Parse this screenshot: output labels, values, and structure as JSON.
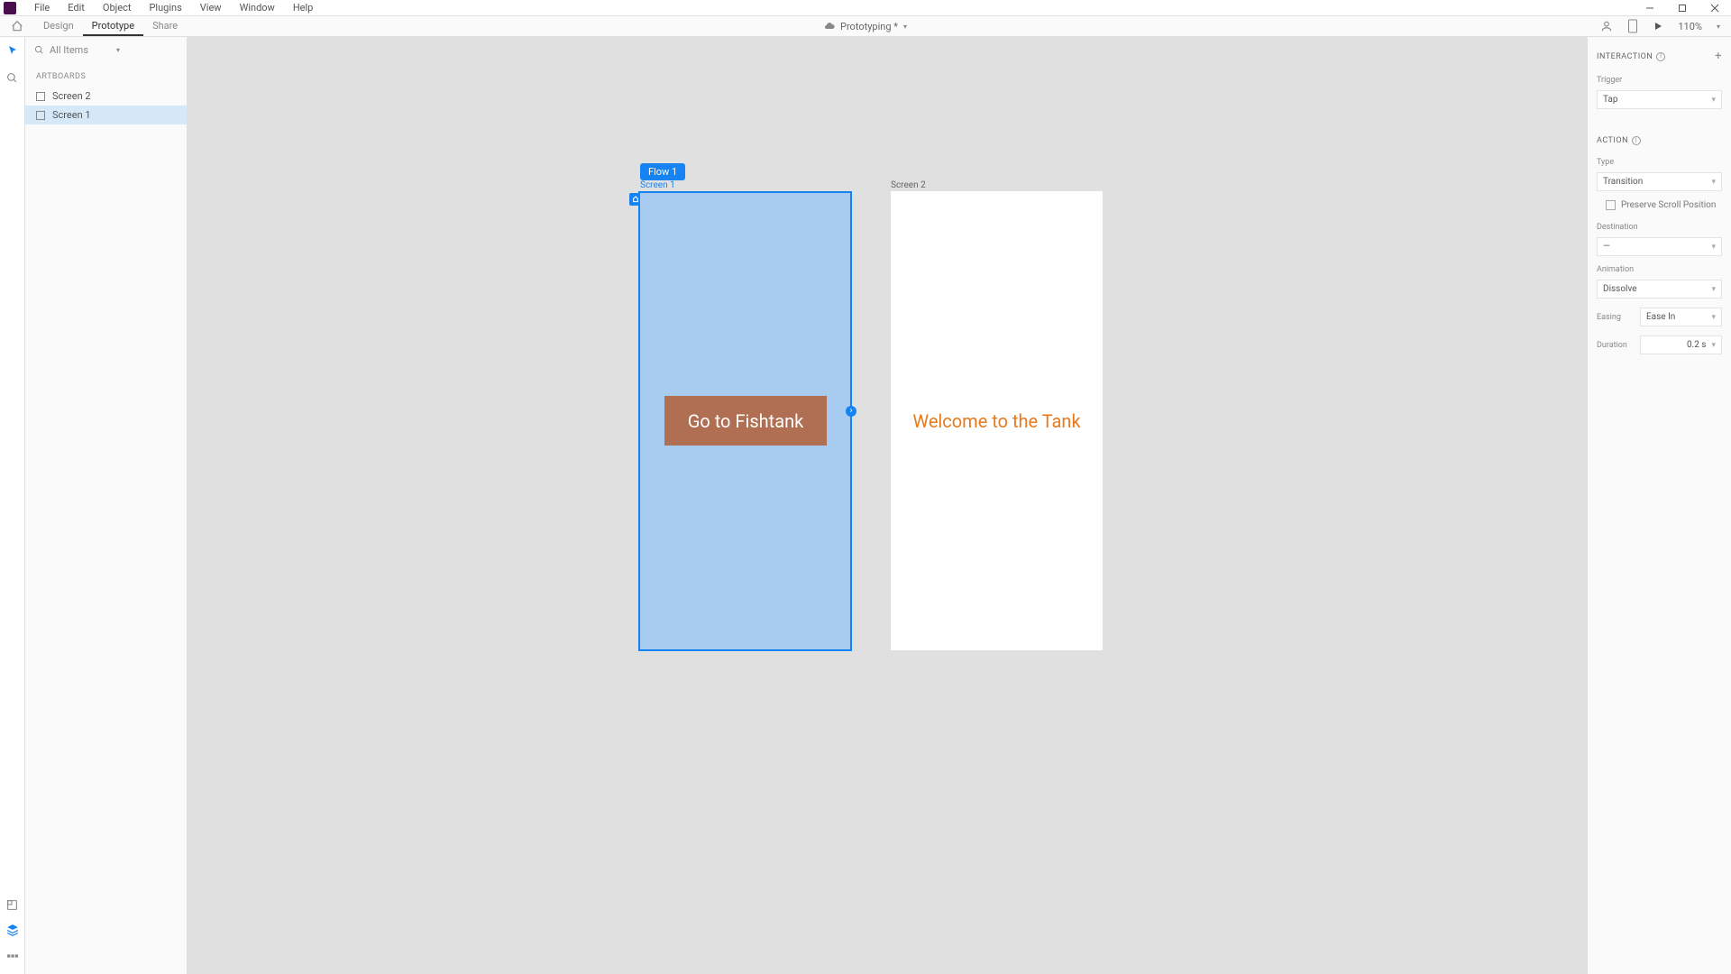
{
  "menu": {
    "file": "File",
    "edit": "Edit",
    "object": "Object",
    "plugins": "Plugins",
    "view": "View",
    "window": "Window",
    "help": "Help"
  },
  "tabs": {
    "design": "Design",
    "prototype": "Prototype",
    "share": "Share"
  },
  "doc": {
    "name": "Prototyping *"
  },
  "zoom": "110%",
  "left": {
    "search_placeholder": "All Items",
    "section": "ARTBOARDS",
    "items": [
      {
        "label": "Screen 2",
        "selected": false
      },
      {
        "label": "Screen 1",
        "selected": true
      }
    ]
  },
  "canvas": {
    "flow_badge": "Flow 1",
    "artboard1_label": "Screen 1",
    "artboard2_label": "Screen 2",
    "button_text": "Go to Fishtank",
    "welcome_text": "Welcome to the Tank"
  },
  "right": {
    "interaction": "INTERACTION",
    "trigger_label": "Trigger",
    "trigger_value": "Tap",
    "action": "ACTION",
    "type_label": "Type",
    "type_value": "Transition",
    "preserve_scroll": "Preserve Scroll Position",
    "destination_label": "Destination",
    "destination_value": "—",
    "animation_label": "Animation",
    "animation_value": "Dissolve",
    "easing_label": "Easing",
    "easing_value": "Ease In",
    "duration_label": "Duration",
    "duration_value": "0.2 s"
  }
}
